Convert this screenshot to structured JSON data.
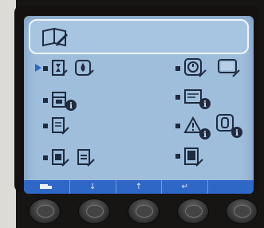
{
  "screen": {
    "header_icon": "book-pen-icon",
    "selected_item": "sequence-hourglass",
    "colors": {
      "screen_bg": "#9fbedb",
      "icon_dark": "#1f2b40",
      "softkey_bar": "#2f67c7",
      "cursor": "#2f67c7"
    },
    "menu_left": [
      {
        "id": "sequence-hourglass",
        "icons": [
          "hourglass-doc-icon",
          "ink-drop-icon"
        ]
      },
      {
        "id": "status-info",
        "icons": [
          "calendar-doc-info-icon"
        ]
      },
      {
        "id": "document",
        "icons": [
          "document-icon"
        ]
      },
      {
        "id": "doc-group",
        "icons": [
          "doc-a-icon",
          "doc-b-icon"
        ]
      }
    ],
    "menu_right": [
      {
        "id": "clock-setup",
        "icons": [
          "clock-icon",
          "box-icon"
        ]
      },
      {
        "id": "folder-info",
        "icons": [
          "folder-info-icon"
        ]
      },
      {
        "id": "warnings",
        "icons": [
          "warning-info-icon",
          "bottle-info-icon"
        ]
      },
      {
        "id": "page",
        "icons": [
          "page-icon"
        ]
      }
    ],
    "softkeys": [
      {
        "label": "",
        "icon": "truck-icon"
      },
      {
        "label": "↓",
        "icon": "arrow-down-icon"
      },
      {
        "label": "↑",
        "icon": "arrow-up-icon"
      },
      {
        "label": "↵",
        "icon": "enter-icon"
      },
      {
        "label": "",
        "icon": "blank"
      }
    ]
  },
  "buttons": [
    {
      "id": "button-1"
    },
    {
      "id": "button-2"
    },
    {
      "id": "button-3"
    },
    {
      "id": "button-4"
    },
    {
      "id": "button-5"
    }
  ]
}
